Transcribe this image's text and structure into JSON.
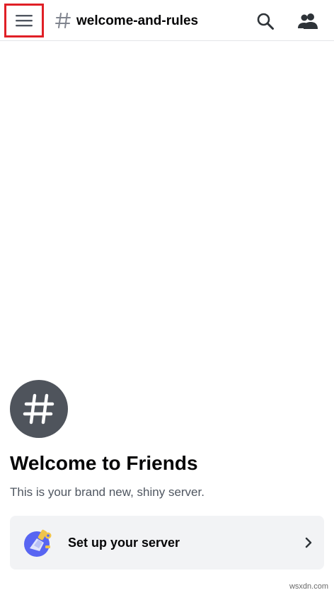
{
  "header": {
    "menu_icon": "hamburger-menu-icon",
    "channel_icon": "hash-icon",
    "channel_name": "welcome-and-rules",
    "search_icon": "search-icon",
    "members_icon": "members-icon",
    "highlight_color": "#e01f26"
  },
  "welcome": {
    "avatar_icon": "hash-icon",
    "title": "Welcome to Friends",
    "subtitle": "This is your brand new, shiny server."
  },
  "setup_card": {
    "icon": "server-setup-icon",
    "label": "Set up your server",
    "chevron_icon": "chevron-right-icon"
  },
  "watermark": "wsxdn.com",
  "colors": {
    "text_primary": "#060607",
    "text_muted": "#4f5660",
    "avatar_bg": "#4f545c",
    "card_bg": "#f2f3f5",
    "accent": "#5865f2"
  }
}
